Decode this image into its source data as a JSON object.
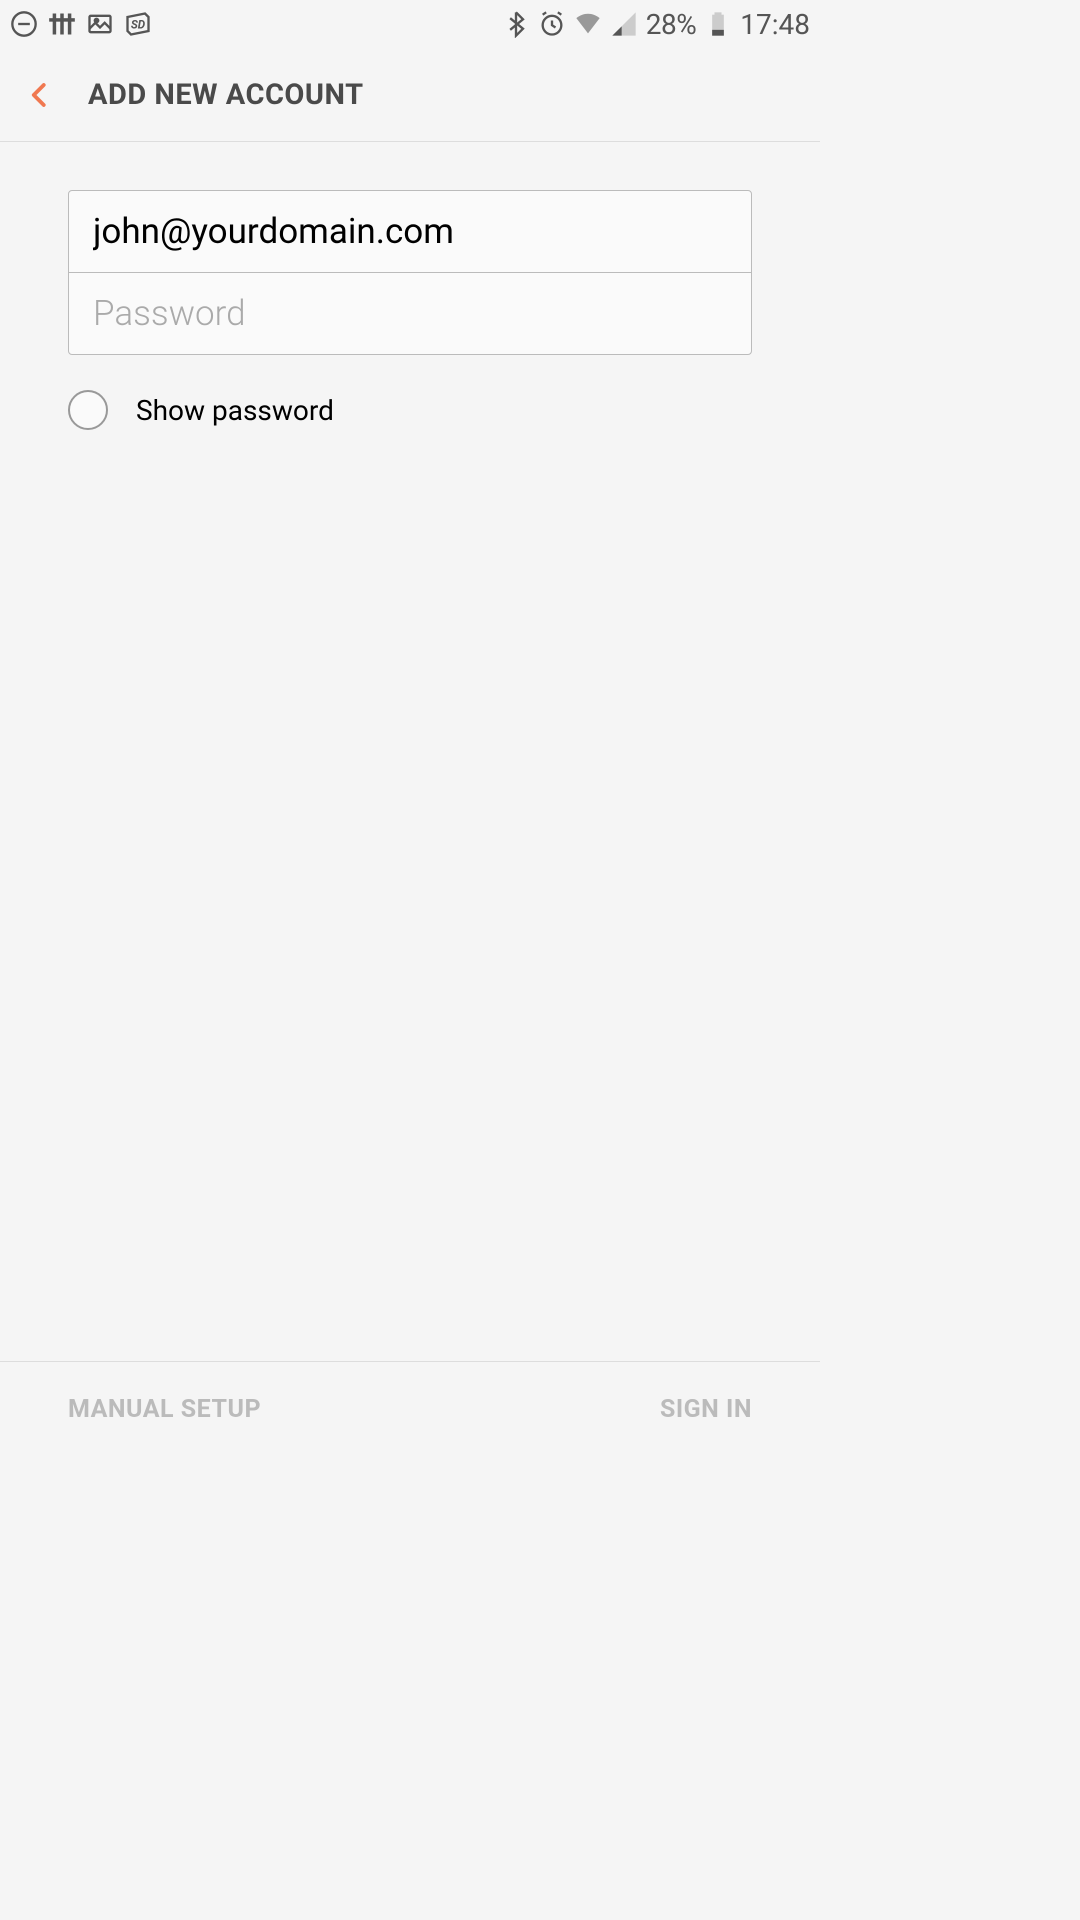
{
  "status_bar": {
    "battery_percent": "28%",
    "time": "17:48"
  },
  "app_bar": {
    "title": "ADD NEW ACCOUNT"
  },
  "form": {
    "email_value": "john@yourdomain.com",
    "password_placeholder": "Password",
    "show_password_label": "Show password"
  },
  "bottom_bar": {
    "manual_setup_label": "MANUAL SETUP",
    "sign_in_label": "SIGN IN"
  }
}
